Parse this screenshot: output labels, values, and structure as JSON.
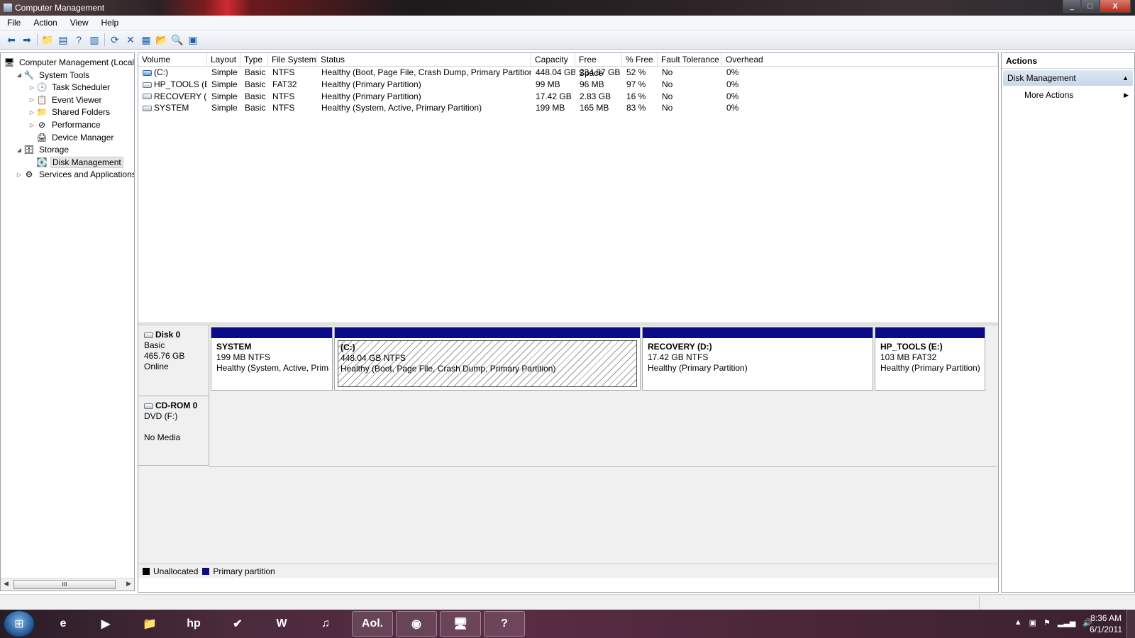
{
  "window": {
    "title": "Computer Management",
    "min": "_",
    "max": "□",
    "close": "X"
  },
  "menu": [
    "File",
    "Action",
    "View",
    "Help"
  ],
  "toolbar": [
    {
      "name": "back-icon",
      "glyph": "⬅"
    },
    {
      "name": "forward-icon",
      "glyph": "➡"
    },
    {
      "name": "up-folder-icon",
      "glyph": "📁"
    },
    {
      "name": "show-hide-console-tree-icon",
      "glyph": "▤"
    },
    {
      "name": "help-icon",
      "glyph": "?"
    },
    {
      "name": "show-hide-action-pane-icon",
      "glyph": "▥"
    },
    {
      "name": "refresh-icon",
      "glyph": "⟳"
    },
    {
      "name": "delete-icon",
      "glyph": "✕"
    },
    {
      "name": "properties-icon",
      "glyph": "▦"
    },
    {
      "name": "open-icon",
      "glyph": "📂"
    },
    {
      "name": "search-icon",
      "glyph": "🔍"
    },
    {
      "name": "export-icon",
      "glyph": "▣"
    }
  ],
  "nav": {
    "items": [
      {
        "label": "Computer Management (Local",
        "icon": "computer-icon",
        "glyph": "🖥",
        "arrow": "",
        "level": 0
      },
      {
        "label": "System Tools",
        "icon": "tools-icon",
        "glyph": "🔧",
        "arrow": "◢",
        "level": 1
      },
      {
        "label": "Task Scheduler",
        "icon": "clock-icon",
        "glyph": "🕓",
        "arrow": "▷",
        "level": 2
      },
      {
        "label": "Event Viewer",
        "icon": "event-viewer-icon",
        "glyph": "📋",
        "arrow": "▷",
        "level": 2
      },
      {
        "label": "Shared Folders",
        "icon": "shared-folder-icon",
        "glyph": "📁",
        "arrow": "▷",
        "level": 2
      },
      {
        "label": "Performance",
        "icon": "performance-icon",
        "glyph": "⊘",
        "arrow": "▷",
        "level": 2
      },
      {
        "label": "Device Manager",
        "icon": "device-manager-icon",
        "glyph": "🖨",
        "arrow": "",
        "level": 2
      },
      {
        "label": "Storage",
        "icon": "storage-icon",
        "glyph": "🗄",
        "arrow": "◢",
        "level": 1
      },
      {
        "label": "Disk Management",
        "icon": "disk-icon",
        "glyph": "💽",
        "arrow": "",
        "level": 2,
        "selected": true
      },
      {
        "label": "Services and Applications",
        "icon": "services-icon",
        "glyph": "⚙",
        "arrow": "▷",
        "level": 1
      }
    ],
    "scroll_thumb": "III"
  },
  "volumes": {
    "columns": [
      "Volume",
      "Layout",
      "Type",
      "File System",
      "Status",
      "Capacity",
      "Free Space",
      "% Free",
      "Fault Tolerance",
      "Overhead"
    ],
    "rows": [
      [
        "(C:)",
        "Simple",
        "Basic",
        "NTFS",
        "Healthy (Boot, Page File, Crash Dump, Primary Partition)",
        "448.04 GB",
        "234.87 GB",
        "52 %",
        "No",
        "0%"
      ],
      [
        "HP_TOOLS (E:)",
        "Simple",
        "Basic",
        "FAT32",
        "Healthy (Primary Partition)",
        "99 MB",
        "96 MB",
        "97 %",
        "No",
        "0%"
      ],
      [
        "RECOVERY (D:)",
        "Simple",
        "Basic",
        "NTFS",
        "Healthy (Primary Partition)",
        "17.42 GB",
        "2.83 GB",
        "16 %",
        "No",
        "0%"
      ],
      [
        "SYSTEM",
        "Simple",
        "Basic",
        "NTFS",
        "Healthy (System, Active, Primary Partition)",
        "199 MB",
        "165 MB",
        "83 %",
        "No",
        "0%"
      ]
    ]
  },
  "disk0": {
    "name": "Disk 0",
    "type": "Basic",
    "size": "465.76 GB",
    "state": "Online",
    "partitions": [
      {
        "name": "SYSTEM",
        "fs": "199 MB NTFS",
        "status": "Healthy (System, Active, Prima"
      },
      {
        "name": "(C:)",
        "fs": "448.04 GB NTFS",
        "status": "Healthy (Boot, Page File, Crash Dump, Primary Partition)"
      },
      {
        "name": "RECOVERY  (D:)",
        "fs": "17.42 GB NTFS",
        "status": "Healthy (Primary Partition)"
      },
      {
        "name": "HP_TOOLS  (E:)",
        "fs": "103 MB FAT32",
        "status": "Healthy (Primary Partition)"
      }
    ]
  },
  "cdrom0": {
    "name": "CD-ROM 0",
    "type": "DVD (F:)",
    "state": "No Media"
  },
  "legend": [
    {
      "label": "Unallocated",
      "color": "#000000"
    },
    {
      "label": "Primary partition",
      "color": "#0b0b8a"
    }
  ],
  "actions": {
    "header": "Actions",
    "section": "Disk Management",
    "item": "More Actions"
  },
  "taskbar": {
    "start_glyph": "⊞",
    "apps": [
      {
        "name": "internet-explorer-icon",
        "glyph": "e"
      },
      {
        "name": "media-player-icon",
        "glyph": "▶"
      },
      {
        "name": "explorer-icon",
        "glyph": "📁"
      },
      {
        "name": "hp-icon",
        "glyph": "hp"
      },
      {
        "name": "checkmark-app-icon",
        "glyph": "✔"
      },
      {
        "name": "word-icon",
        "glyph": "W"
      },
      {
        "name": "itunes-icon",
        "glyph": "♫"
      },
      {
        "name": "aol-icon",
        "glyph": "Aol."
      },
      {
        "name": "app-orb-icon",
        "glyph": "◉"
      },
      {
        "name": "computer-management-icon",
        "glyph": "🖥"
      },
      {
        "name": "help-support-icon",
        "glyph": "?"
      }
    ],
    "time": "8:36 AM",
    "date": "6/1/2011"
  }
}
